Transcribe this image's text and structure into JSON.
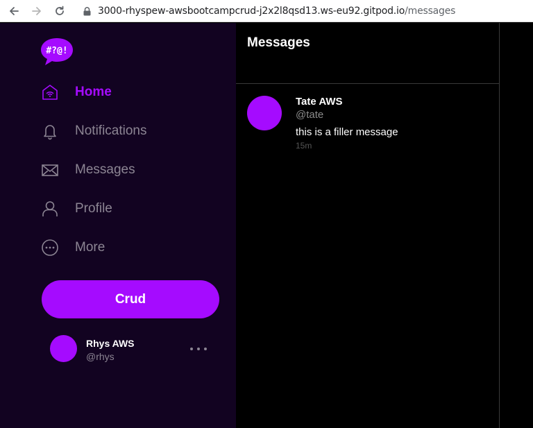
{
  "browser": {
    "url_host": "3000-rhyspew-awsbootcampcrud-j2x2l8qsd13.ws-eu92.gitpod.io",
    "url_path": "/messages"
  },
  "sidebar": {
    "logo_text": "#?@!",
    "nav": [
      {
        "label": "Home",
        "icon": "home-icon",
        "active": true
      },
      {
        "label": "Notifications",
        "icon": "bell-icon",
        "active": false
      },
      {
        "label": "Messages",
        "icon": "envelope-icon",
        "active": false
      },
      {
        "label": "Profile",
        "icon": "person-icon",
        "active": false
      },
      {
        "label": "More",
        "icon": "more-circle-icon",
        "active": false
      }
    ],
    "crud_label": "Crud",
    "user": {
      "name": "Rhys AWS",
      "handle": "@rhys"
    }
  },
  "main": {
    "title": "Messages",
    "messages": [
      {
        "name": "Tate AWS",
        "handle": "@tate",
        "body": "this is a filler message",
        "time": "15m"
      }
    ]
  },
  "colors": {
    "accent": "#a50bff",
    "sidebar_bg": "#120321",
    "main_bg": "#000000",
    "muted_text": "#8c8593"
  }
}
